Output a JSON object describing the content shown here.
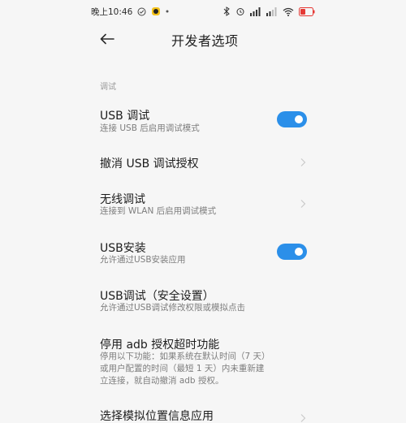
{
  "status": {
    "time": "晚上10:46",
    "icons_left": [
      "check-badge-icon",
      "notification-icon",
      "dot-icon"
    ],
    "icons_right": [
      "bluetooth-icon",
      "alarm-icon",
      "signal-icon",
      "signal2-icon",
      "wifi-icon",
      "battery-icon"
    ]
  },
  "header": {
    "title": "开发者选项"
  },
  "section": {
    "label": "调试"
  },
  "rows": [
    {
      "title": "USB 调试",
      "subtitle": "连接 USB 后启用调试模式",
      "control": "toggle-on"
    },
    {
      "title": "撤消 USB 调试授权",
      "subtitle": "",
      "control": "chevron"
    },
    {
      "title": "无线调试",
      "subtitle": "连接到 WLAN 后启用调试模式",
      "control": "chevron"
    },
    {
      "title": "USB安装",
      "subtitle": "允许通过USB安装应用",
      "control": "toggle-on"
    },
    {
      "title": "USB调试（安全设置）",
      "subtitle": "允许通过USB调试修改权限或模拟点击",
      "control": "none"
    },
    {
      "title": "停用 adb 授权超时功能",
      "subtitle": "停用以下功能：如果系统在默认时间（7 天）或用户配置的时间（最短 1 天）内未重新建立连接，就自动撤消 adb 授权。",
      "control": "none"
    },
    {
      "title": "选择模拟位置信息应用",
      "subtitle": "",
      "control": "chevron"
    }
  ],
  "colors": {
    "accent": "#2b8fe9",
    "background": "#f6f6f6",
    "battery": "#e53935"
  }
}
